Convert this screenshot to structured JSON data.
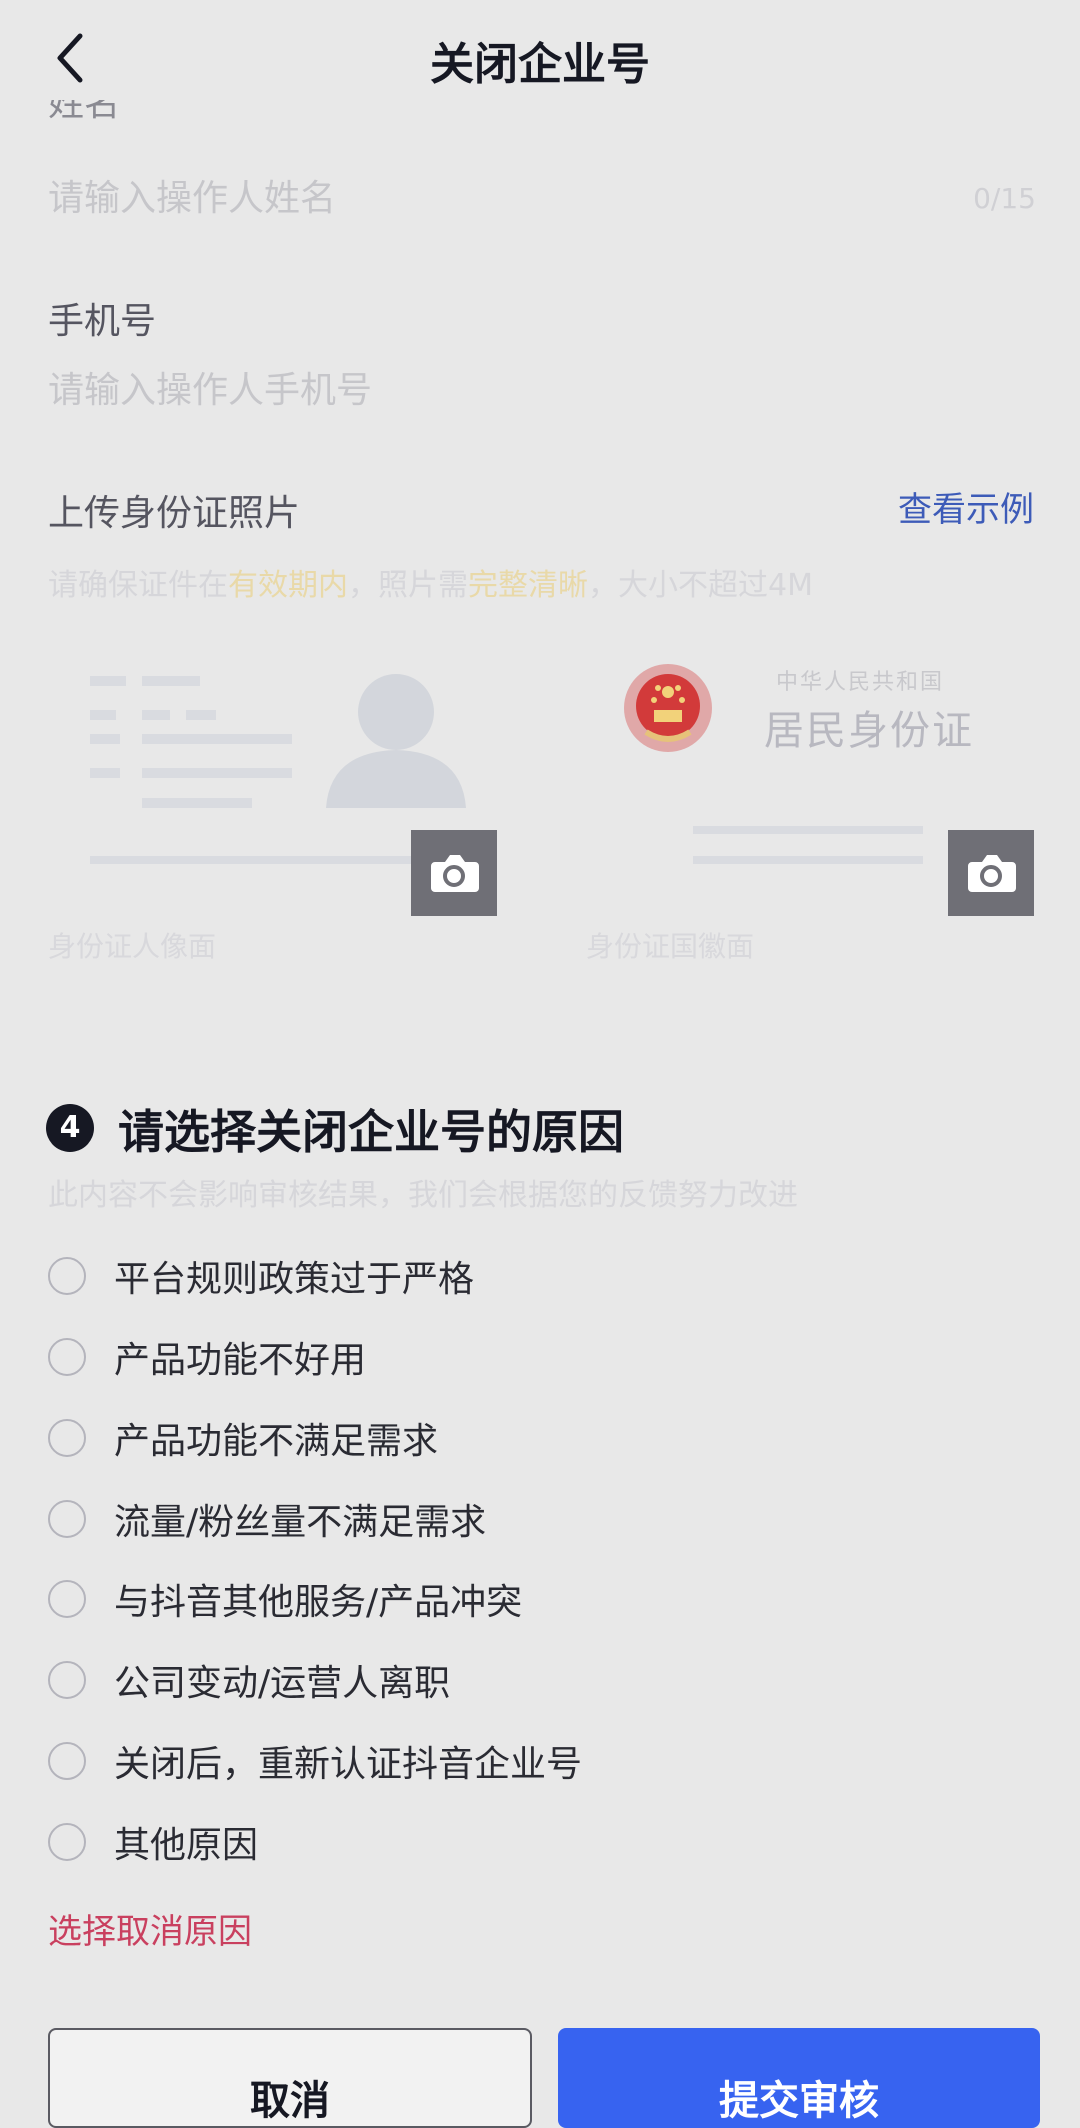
{
  "nav": {
    "title": "关闭企业号",
    "back_icon": "chevron-left-icon"
  },
  "operator": {
    "name_label": "姓名",
    "name_placeholder": "请输入操作人姓名",
    "name_counter": "0/15",
    "phone_label": "手机号",
    "phone_placeholder": "请输入操作人手机号"
  },
  "id_upload": {
    "label": "上传身份证照片",
    "example_link": "查看示例",
    "hint_parts": [
      "请确保证件在",
      "有效期内",
      "，照片需",
      "完整清晰",
      "，大小不超过4M"
    ],
    "front_caption": "身份证人像面",
    "back_caption": "身份证国徽面",
    "back_card_country": "中华人民共和国",
    "back_card_title": "居民身份证",
    "camera_icon": "camera-icon"
  },
  "reasons": {
    "step_number": "4",
    "title": "请选择关闭企业号的原因",
    "subtitle": "此内容不会影响审核结果，我们会根据您的反馈努力改进",
    "options": [
      "平台规则政策过于严格",
      "产品功能不好用",
      "产品功能不满足需求",
      "流量/粉丝量不满足需求",
      "与抖音其他服务/产品冲突",
      "公司变动/运营人离职",
      "关闭后，重新认证抖音企业号",
      "其他原因"
    ],
    "error": "选择取消原因"
  },
  "actions": {
    "cancel": "取消",
    "submit": "提交审核"
  },
  "colors": {
    "accent": "#3763f0",
    "link": "#3d5bb8",
    "error": "#c9405f",
    "text": "#161823",
    "background": "#e8e8e8"
  }
}
